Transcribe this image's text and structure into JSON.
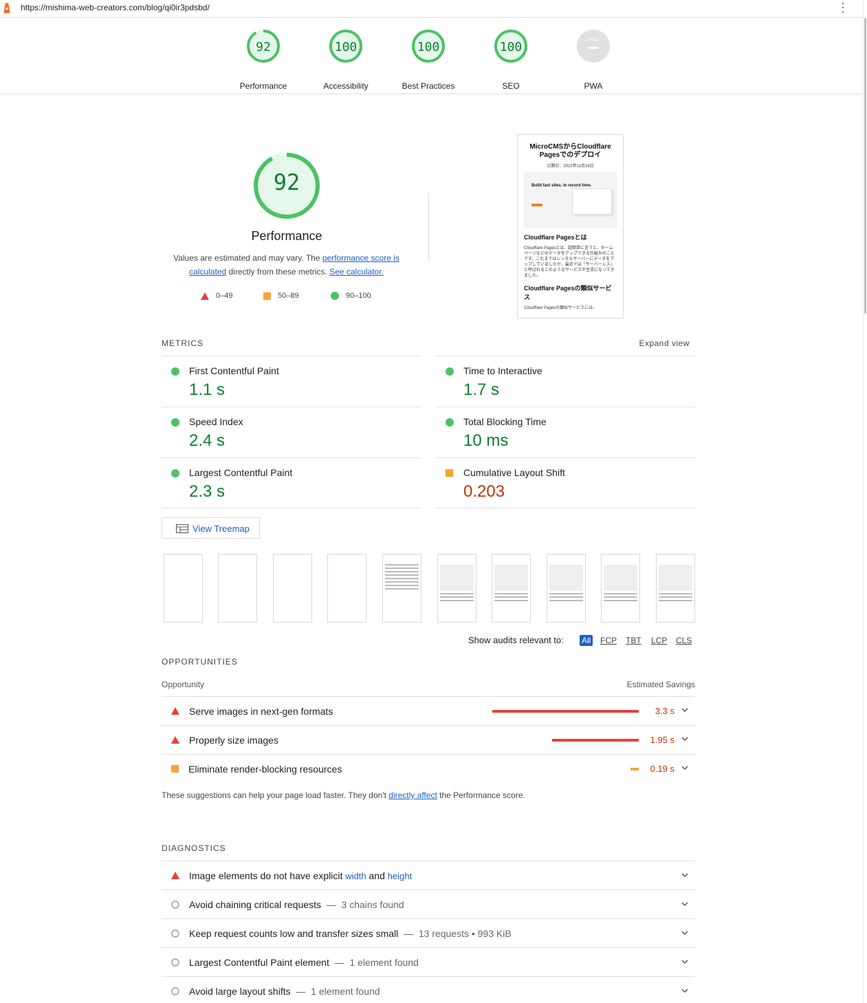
{
  "browser": {
    "url": "https://mishima-web-creators.com/blog/qi0ir3pdsbd/"
  },
  "colors": {
    "pass": "#0c7f2f",
    "pass_icon": "#4cc264",
    "average": "#f4a533",
    "fail": "#e8403a",
    "link": "#1a5ec7"
  },
  "scores": [
    {
      "label": "Performance",
      "value": "92",
      "fraction": 0.92
    },
    {
      "label": "Accessibility",
      "value": "100",
      "fraction": 1.0
    },
    {
      "label": "Best Practices",
      "value": "100",
      "fraction": 1.0
    },
    {
      "label": "SEO",
      "value": "100",
      "fraction": 1.0
    },
    {
      "label": "PWA",
      "value": "",
      "badge": "PWA"
    }
  ],
  "performance": {
    "score": "92",
    "fraction": 0.92,
    "title": "Performance",
    "desc_1": "Values are estimated and may vary. The ",
    "desc_link_1": "performance score is calculated",
    "desc_2": " directly from these metrics. ",
    "desc_link_2": "See calculator.",
    "legend": [
      "0–49",
      "50–89",
      "90–100"
    ]
  },
  "screenshot": {
    "heading": "MicroCMSからCloudflare Pagesでのデプロイ",
    "date": "公開日：2022年11月16日",
    "hero_text": "Build fast sites. In record time.",
    "section_1": "Cloudflare Pagesとは",
    "para_1": "Cloudflare Pagesとは、超簡単に言うと、ホームページなどのデータをアップできる仕組みのことです。これまではレンタルサーバーにデータをアップしていましたが、最近では「サーバーレス」と呼ばれるこのようなサービスが主流になってきました。",
    "section_2": "Cloudflare Pagesの類似サービス",
    "para_2": "Cloudflare Pagesの類似サービスには、"
  },
  "metrics": {
    "heading": "METRICS",
    "expand": "Expand view",
    "items": [
      {
        "name": "First Contentful Paint",
        "value": "1.1 s",
        "rating": "pass"
      },
      {
        "name": "Time to Interactive",
        "value": "1.7 s",
        "rating": "pass"
      },
      {
        "name": "Speed Index",
        "value": "2.4 s",
        "rating": "pass"
      },
      {
        "name": "Total Blocking Time",
        "value": "10 ms",
        "rating": "pass"
      },
      {
        "name": "Largest Contentful Paint",
        "value": "2.3 s",
        "rating": "pass"
      },
      {
        "name": "Cumulative Layout Shift",
        "value": "0.203",
        "rating": "average"
      }
    ]
  },
  "treemap": {
    "label": "View Treemap"
  },
  "filters": {
    "label": "Show audits relevant to:",
    "chips": [
      "All",
      "FCP",
      "TBT",
      "LCP",
      "CLS"
    ]
  },
  "opportunities": {
    "heading": "OPPORTUNITIES",
    "col_left": "Opportunity",
    "col_right": "Estimated Savings",
    "items": [
      {
        "title": "Serve images in next-gen formats",
        "savings": "3.3 s",
        "seconds": 3.3,
        "rating": "fail"
      },
      {
        "title": "Properly size images",
        "savings": "1.95 s",
        "seconds": 1.95,
        "rating": "fail"
      },
      {
        "title": "Eliminate render-blocking resources",
        "savings": "0.19 s",
        "seconds": 0.19,
        "rating": "average"
      }
    ],
    "footer_1": "These suggestions can help your page load faster. They don't ",
    "footer_link": "directly affect",
    "footer_2": " the Performance score."
  },
  "diagnostics": {
    "heading": "DIAGNOSTICS",
    "items": [
      {
        "pre": "Image elements do not have explicit ",
        "code_1": "width",
        "mid": " and ",
        "code_2": "height",
        "sub": "",
        "rating": "fail"
      },
      {
        "pre": "Avoid chaining critical requests",
        "sub": "3 chains found",
        "rating": "info"
      },
      {
        "pre": "Keep request counts low and transfer sizes small",
        "sub": "13 requests • 993 KiB",
        "rating": "info"
      },
      {
        "pre": "Largest Contentful Paint element",
        "sub": "1 element found",
        "rating": "info"
      },
      {
        "pre": "Avoid large layout shifts",
        "sub": "1 element found",
        "rating": "info"
      }
    ]
  }
}
